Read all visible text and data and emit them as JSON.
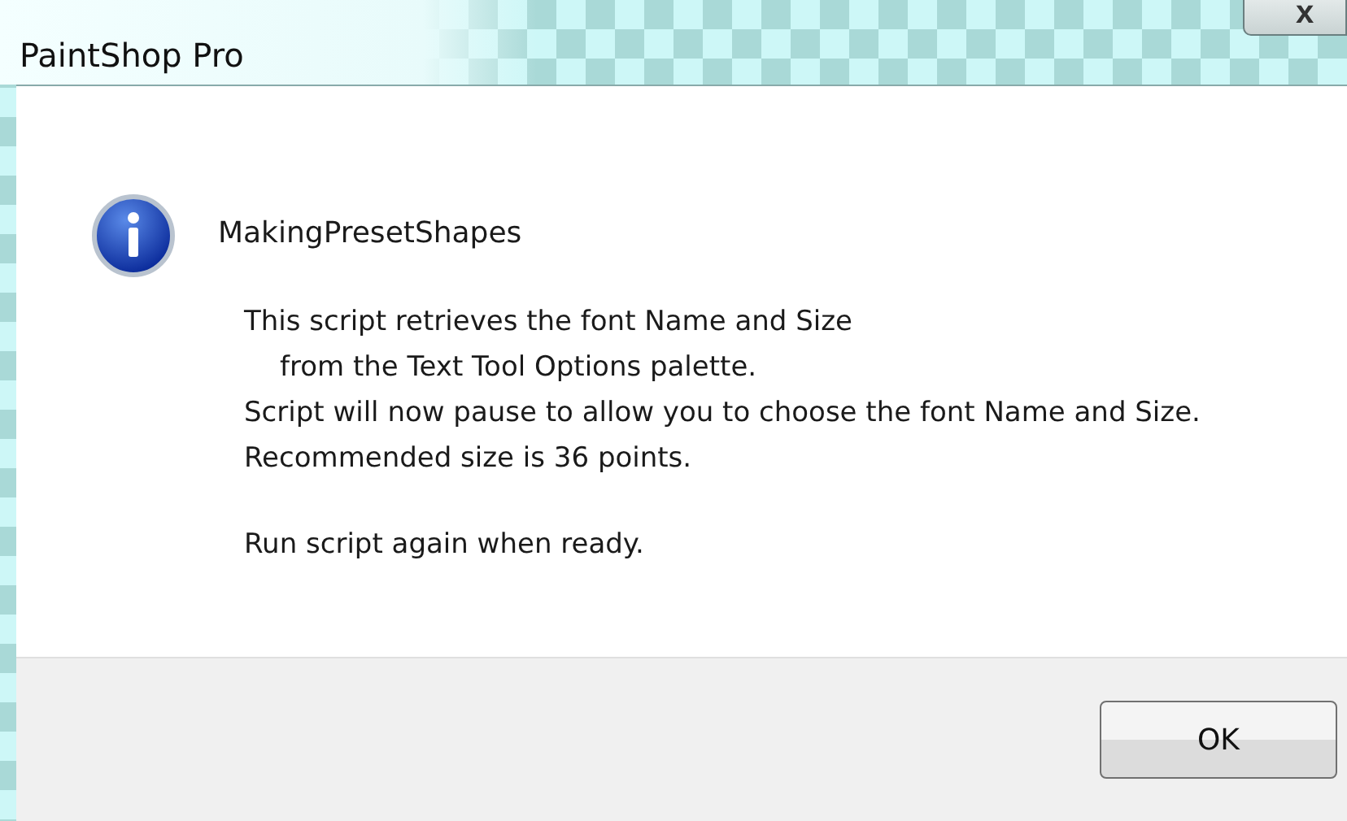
{
  "window": {
    "title": "PaintShop Pro",
    "close": "x"
  },
  "message": {
    "heading": "MakingPresetShapes",
    "lines": [
      {
        "text": "This script retrieves the font Name and Size",
        "indented": false
      },
      {
        "text": "from the Text Tool Options palette.",
        "indented": true
      },
      {
        "text": "Script will now pause to allow you to choose the font Name and Size.",
        "indented": false
      },
      {
        "text": "Recommended size is 36 points.",
        "indented": false
      },
      {
        "text": "Run script again when ready.",
        "indented": false,
        "gap_before": true
      }
    ]
  },
  "buttons": [
    "OK"
  ]
}
